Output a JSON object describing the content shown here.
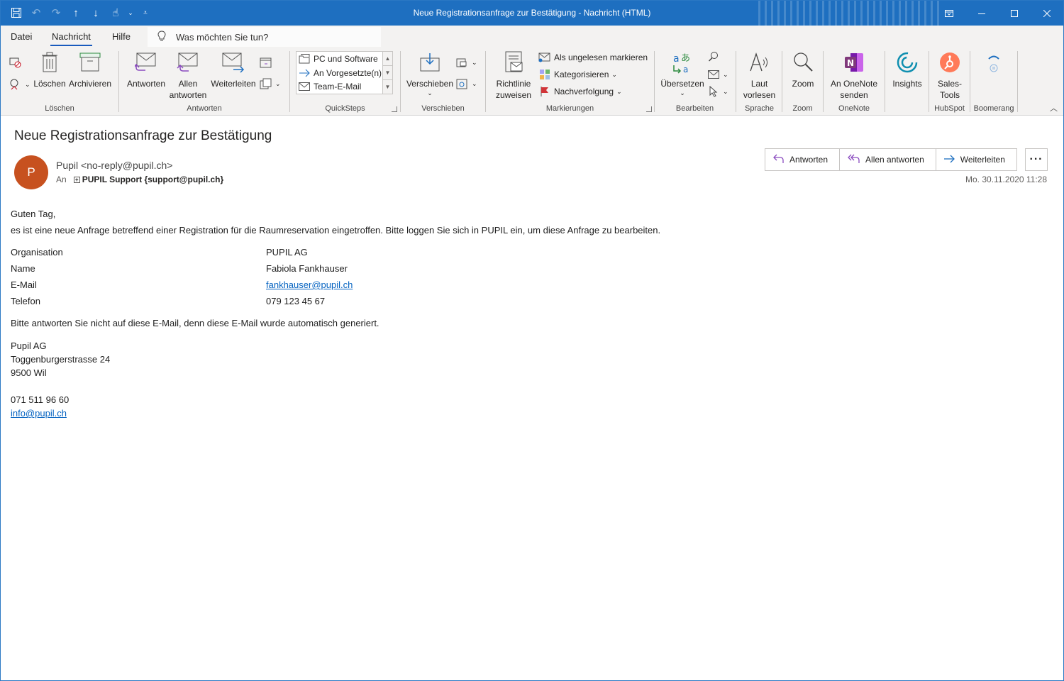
{
  "window": {
    "title": "Neue Registrationsanfrage zur Bestätigung  -  Nachricht (HTML)",
    "accent": "#1e6fc0"
  },
  "menu": {
    "tabs": [
      "Datei",
      "Nachricht",
      "Hilfe"
    ],
    "active_tab": "Nachricht",
    "tell_me": "Was möchten Sie tun?"
  },
  "ribbon": {
    "loeschen": {
      "label": "Löschen",
      "delete": "Löschen",
      "archive": "Archivieren"
    },
    "antworten": {
      "label": "Antworten",
      "reply": "Antworten",
      "reply_all_1": "Allen",
      "reply_all_2": "antworten",
      "forward": "Weiterleiten"
    },
    "quicksteps": {
      "label": "QuickSteps",
      "items": [
        "PC und Software",
        "An Vorgesetzte(n)",
        "Team-E-Mail"
      ]
    },
    "verschieben": {
      "label": "Verschieben",
      "move": "Verschieben"
    },
    "markierungen": {
      "label": "Markierungen",
      "policy_1": "Richtlinie",
      "policy_2": "zuweisen",
      "unread": "Als ungelesen markieren",
      "categorize": "Kategorisieren",
      "followup": "Nachverfolgung"
    },
    "bearbeiten": {
      "label": "Bearbeiten",
      "translate": "Übersetzen"
    },
    "sprache": {
      "label": "Sprache",
      "read_1": "Laut",
      "read_2": "vorlesen"
    },
    "zoom": {
      "label": "Zoom",
      "zoom": "Zoom"
    },
    "onenote": {
      "label": "OneNote",
      "send_1": "An OneNote",
      "send_2": "senden"
    },
    "insights": {
      "label": "Insights"
    },
    "hubspot": {
      "label": "HubSpot",
      "tools_1": "Sales-",
      "tools_2": "Tools"
    },
    "boomerang": {
      "label": "Boomerang"
    }
  },
  "message": {
    "subject": "Neue Registrationsanfrage zur Bestätigung",
    "avatar_initial": "P",
    "avatar_color": "#c7511f",
    "from": "Pupil <no-reply@pupil.ch>",
    "to_label": "An",
    "to": "PUPIL Support {support@pupil.ch}",
    "date": "Mo. 30.11.2020 11:28",
    "actions": {
      "reply": "Antworten",
      "reply_all": "Allen antworten",
      "forward": "Weiterleiten",
      "more": "···"
    }
  },
  "body": {
    "greeting": "Guten Tag,",
    "intro": "es ist eine neue Anfrage betreffend einer Registration für die Raumreservation eingetroffen. Bitte loggen Sie sich in PUPIL ein, um diese Anfrage zu bearbeiten.",
    "fields": [
      {
        "key": "Organisation",
        "value": "PUPIL AG"
      },
      {
        "key": "Name",
        "value": "Fabiola Fankhauser"
      },
      {
        "key": "E-Mail",
        "value": "fankhauser@pupil.ch"
      },
      {
        "key": "Telefon",
        "value": "079 123 45 67"
      }
    ],
    "notice": "Bitte antworten Sie nicht auf diese E-Mail, denn diese E-Mail wurde automatisch generiert.",
    "signature": {
      "company": "Pupil AG",
      "street": "Toggenburgerstrasse 24",
      "city": "9500 Wil",
      "phone": "071 511 96 60",
      "email": "info@pupil.ch"
    }
  }
}
